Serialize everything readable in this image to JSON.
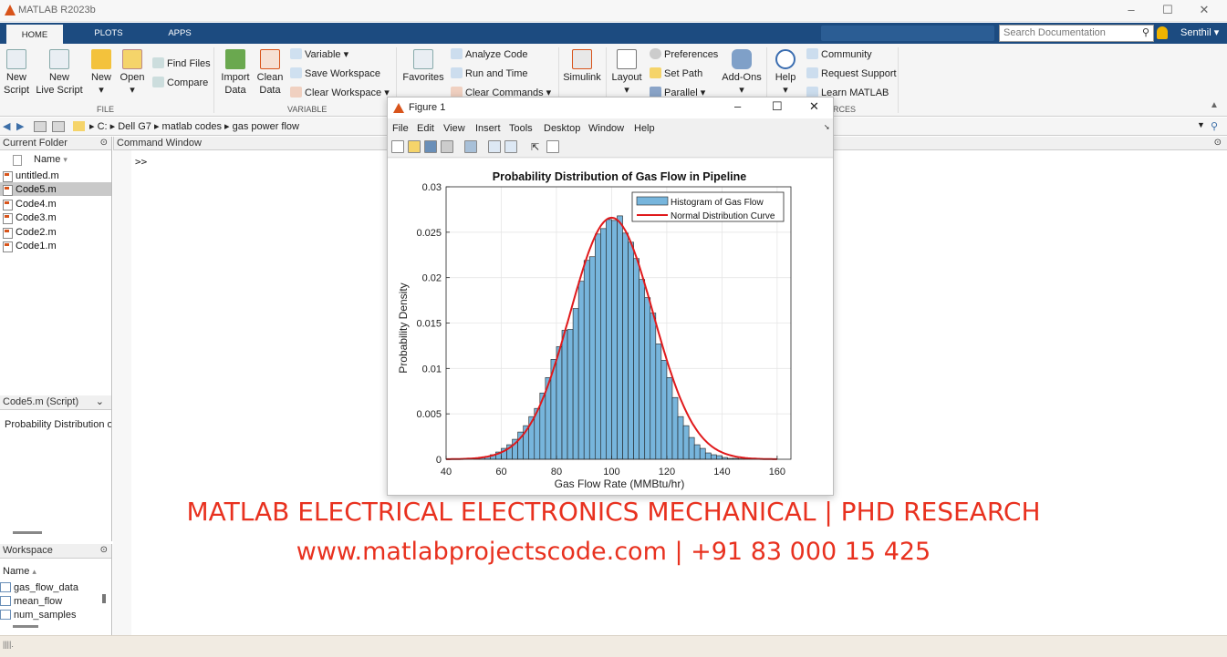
{
  "window": {
    "title": "MATLAB R2023b"
  },
  "tabs": [
    "HOME",
    "PLOTS",
    "APPS"
  ],
  "search": {
    "placeholder": "Search Documentation"
  },
  "user": "Senthil",
  "ribbon": {
    "file": {
      "new_script": "New\nScript",
      "new_live_script": "New\nLive Script",
      "new": "New",
      "open": "Open",
      "find_files": "Find Files",
      "compare": "Compare",
      "label": "FILE"
    },
    "variable": {
      "import_data": "Import\nData",
      "clean_data": "Clean\nData",
      "variable": "Variable",
      "save_workspace": "Save Workspace",
      "clear_workspace": "Clear Workspace",
      "label": "VARIABLE"
    },
    "code": {
      "favorites": "Favorites",
      "analyze_code": "Analyze Code",
      "run_and_time": "Run and Time",
      "clear_commands": "Clear Commands"
    },
    "simulink": "Simulink",
    "environment": {
      "layout": "Layout",
      "preferences": "Preferences",
      "set_path": "Set Path",
      "parallel": "Parallel",
      "add_ons": "Add-Ons"
    },
    "resources": {
      "help": "Help",
      "community": "Community",
      "request_support": "Request Support",
      "learn_matlab": "Learn MATLAB",
      "label": "RCES"
    }
  },
  "address": [
    "C:",
    "Dell G7",
    "matlab codes",
    "gas power flow"
  ],
  "current_folder": {
    "title": "Current Folder",
    "col": "Name",
    "files": [
      "untitled.m",
      "Code5.m",
      "Code4.m",
      "Code3.m",
      "Code2.m",
      "Code1.m"
    ],
    "selected": "Code5.m"
  },
  "details": {
    "title": "Code5.m  (Script)",
    "text": "Probability Distribution o"
  },
  "workspace": {
    "title": "Workspace",
    "col": "Name",
    "vars": [
      "gas_flow_data",
      "mean_flow",
      "num_samples"
    ]
  },
  "command_window": {
    "title": "Command Window",
    "fx": "fx",
    "prompt": ">>"
  },
  "figure": {
    "title": "Figure 1",
    "menu": [
      "File",
      "Edit",
      "View",
      "Insert",
      "Tools",
      "Desktop",
      "Window",
      "Help"
    ]
  },
  "chart_data": {
    "type": "bar",
    "title": "Probability Distribution of Gas Flow in Pipeline",
    "xlabel": "Gas Flow Rate (MMBtu/hr)",
    "ylabel": "Probability Density",
    "xlim": [
      40,
      165
    ],
    "ylim": [
      0,
      0.03
    ],
    "xticks": [
      "40",
      "60",
      "80",
      "100",
      "120",
      "140",
      "160"
    ],
    "yticks": [
      "0",
      "0.005",
      "0.01",
      "0.015",
      "0.02",
      "0.025",
      "0.03"
    ],
    "grid": true,
    "legend_position": "top-right",
    "series": [
      {
        "name": "Histogram of Gas Flow",
        "type": "histogram",
        "color": "#77b5dc",
        "bin_width": 2,
        "bin_start": [
          50,
          52,
          54,
          56,
          58,
          60,
          62,
          64,
          66,
          68,
          70,
          72,
          74,
          76,
          78,
          80,
          82,
          84,
          86,
          88,
          90,
          92,
          94,
          96,
          98,
          100,
          102,
          104,
          106,
          108,
          110,
          112,
          114,
          116,
          118,
          120,
          122,
          124,
          126,
          128,
          130,
          132,
          134,
          136,
          138,
          140,
          142,
          144,
          146,
          148,
          150,
          152
        ],
        "values": [
          0.0001,
          0.0002,
          0.0003,
          0.0005,
          0.0008,
          0.0012,
          0.0016,
          0.0022,
          0.003,
          0.0037,
          0.0047,
          0.0056,
          0.0073,
          0.009,
          0.011,
          0.0124,
          0.0142,
          0.0143,
          0.0166,
          0.0196,
          0.0219,
          0.0223,
          0.0248,
          0.0254,
          0.0264,
          0.0263,
          0.0268,
          0.0249,
          0.0239,
          0.0221,
          0.0198,
          0.0178,
          0.0161,
          0.0127,
          0.0109,
          0.009,
          0.0068,
          0.0047,
          0.0037,
          0.0024,
          0.0016,
          0.0012,
          0.0007,
          0.0005,
          0.0004,
          0.0002,
          0.0001,
          0.0001,
          5e-05,
          5e-05,
          5e-05,
          5e-05
        ]
      },
      {
        "name": "Normal Distribution Curve",
        "type": "line",
        "color": "#e0191b",
        "mean": 100,
        "std": 15
      }
    ]
  },
  "banner": {
    "line1": "MATLAB ELECTRICAL ELECTRONICS MECHANICAL | PHD RESEARCH",
    "line2": "www.matlabprojectscode.com | +91 83 000 15 425"
  }
}
